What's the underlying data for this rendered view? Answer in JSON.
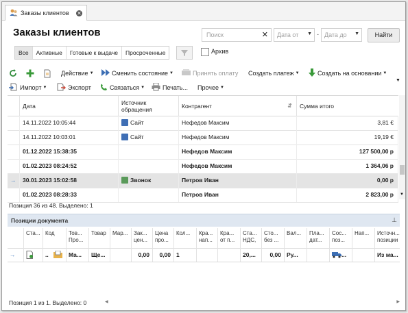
{
  "window": {
    "tab_label": "Заказы клиентов",
    "tab_close": "✕"
  },
  "header": {
    "title": "Заказы клиентов",
    "search_placeholder": "Поиск",
    "search_clear": "✕",
    "date_from_placeholder": "Дата от",
    "date_to_placeholder": "Дата до",
    "date_separator": "-",
    "find_button": "Найти"
  },
  "filters": {
    "tabs": [
      "Все",
      "Активные",
      "Готовые к выдаче",
      "Просроченные"
    ],
    "active_index": 0,
    "archive_label": "Архив",
    "archive_checked": false
  },
  "toolbar": {
    "action": "Действие",
    "change_state": "Сменить состояние",
    "accept_payment": "Принять оплату",
    "create_payment": "Создать платеж",
    "create_based_on": "Создать на основании",
    "import": "Импорт",
    "export": "Экспорт",
    "contact": "Связаться",
    "print": "Печать...",
    "other": "Прочее"
  },
  "orders": {
    "columns": {
      "date": "Дата",
      "source": "Источник обращения",
      "counterparty": "Контрагент",
      "sum": "Сумма итого"
    },
    "rows": [
      {
        "date": "14.11.2022 10:05:44",
        "source": "Сайт",
        "counterparty": "Нефедов Максим",
        "sum": "3,81 €",
        "bold": false,
        "selected": false
      },
      {
        "date": "14.11.2022 10:03:01",
        "source": "Сайт",
        "counterparty": "Нефедов Максим",
        "sum": "19,19 €",
        "bold": false,
        "selected": false
      },
      {
        "date": "01.12.2022 15:38:35",
        "source": "",
        "counterparty": "Нефедов Максим",
        "sum": "127 500,00 р",
        "bold": true,
        "selected": false
      },
      {
        "date": "01.02.2023 08:24:52",
        "source": "",
        "counterparty": "Нефедов Максим",
        "sum": "1 364,06 р",
        "bold": true,
        "selected": false
      },
      {
        "date": "30.01.2023 15:02:58",
        "source": "Звонок",
        "counterparty": "Петров  Иван",
        "sum": "0,00 р",
        "bold": true,
        "selected": true
      },
      {
        "date": "01.02.2023 08:28:33",
        "source": "",
        "counterparty": "Петров  Иван",
        "sum": "2 823,00 р",
        "bold": true,
        "selected": false
      }
    ],
    "status": "Позиция 36 из 48. Выделено: 1"
  },
  "positions": {
    "title": "Позиции документа",
    "columns": [
      "Ста...",
      "Код",
      "Тов... Про...",
      "Товар",
      "Мар...",
      "Зак... цен...",
      "Цена про...",
      "Кол...",
      "Кра... нап...",
      "Кра... от п...",
      "Ста... НДС,",
      "Сто... без ...",
      "Вал...",
      "Пла... дат...",
      "Сос... поз...",
      "Нап...",
      "Источн... позиции"
    ],
    "row": {
      "code": "..",
      "c2": "Ма...",
      "goods": "Ще...",
      "purchase_price": "0,00",
      "price": "0,00",
      "qty": "1",
      "vat": "20,...",
      "cost": "0,00",
      "currency": "Ру...",
      "source": "Из ма..."
    },
    "status": "Позиция 1 из 1. Выделено: 0"
  },
  "colors": {
    "site_source": "#3f6fb5",
    "call_source": "#5a9a5a",
    "panel_header": "#dfe7f1",
    "selected_row": "#e4e4e4"
  }
}
